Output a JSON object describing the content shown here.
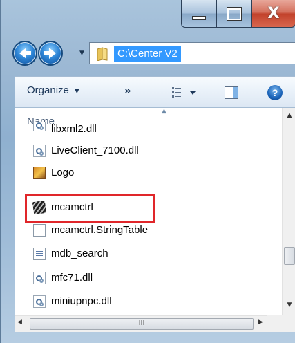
{
  "window": {
    "minimize_glyph": "minimize-icon",
    "maximize_glyph": "maximize-icon",
    "close_label": "X"
  },
  "navigation": {
    "back_icon": "back-arrow-icon",
    "forward_icon": "forward-arrow-icon",
    "history_dropdown": "▼"
  },
  "address": {
    "path": "C:\\Center V2",
    "folder_icon": "folder-icon"
  },
  "toolbar": {
    "organize_label": "Organize",
    "organize_dropdown": "▼",
    "more_label": "»",
    "views_icon": "views-icon",
    "views_dropdown": "▼",
    "preview_icon": "preview-pane-icon",
    "help_label": "?"
  },
  "column_header": {
    "name_label": "Name",
    "sort_indicator": "▲"
  },
  "files": [
    {
      "name": "libxml2.dll",
      "icon": "dll"
    },
    {
      "name": "LiveClient_7100.dll",
      "icon": "dll"
    },
    {
      "name": "Logo",
      "icon": "image"
    },
    {
      "name": "mcamctrl",
      "icon": "executable"
    },
    {
      "name": "mcamctrl.StringTable",
      "icon": "blank-document"
    },
    {
      "name": "mdb_search",
      "icon": "text-document"
    },
    {
      "name": "mfc71.dll",
      "icon": "dll"
    },
    {
      "name": "miniupnpc.dll",
      "icon": "dll"
    }
  ],
  "scrollbars": {
    "up": "▲",
    "down": "▼",
    "left": "◀",
    "right": "▶",
    "h_thumb_grip": "III"
  },
  "annotation": {
    "highlight_color": "#e0262a",
    "highlighted_file": "mcamctrl"
  }
}
